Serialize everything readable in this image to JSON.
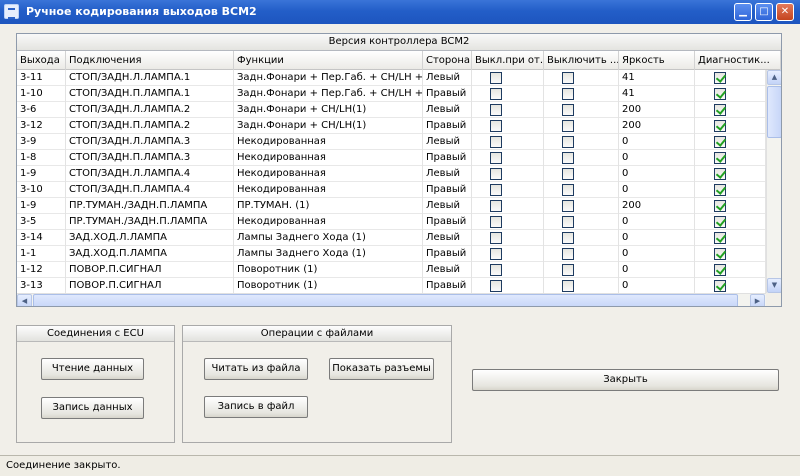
{
  "window": {
    "title": "Ручное кодирования выходов BCM2",
    "icon": "app-icon"
  },
  "grid": {
    "caption": "Версия контроллера BCM2",
    "columns": [
      "Выхода",
      "Подключения",
      "Функции",
      "Сторона",
      "Выкл.при от...",
      "Выключить ...",
      "Яркость",
      "Диагностик..."
    ],
    "rows": [
      {
        "out": "3-11",
        "conn": "СТОП/ЗАДН.Л.ЛАМПА.1",
        "func": "Задн.Фонари + Пер.Габ. + CH/LH +...",
        "side": "Левый",
        "off_when": false,
        "turn_off": false,
        "brightness": "41",
        "diag": true
      },
      {
        "out": "1-10",
        "conn": "СТОП/ЗАДН.П.ЛАМПА.1",
        "func": "Задн.Фонари + Пер.Габ. + CH/LH +...",
        "side": "Правый",
        "off_when": false,
        "turn_off": false,
        "brightness": "41",
        "diag": true
      },
      {
        "out": "3-6",
        "conn": "СТОП/ЗАДН.Л.ЛАМПА.2",
        "func": "Задн.Фонари + CH/LH(1)",
        "side": "Левый",
        "off_when": false,
        "turn_off": false,
        "brightness": "200",
        "diag": true
      },
      {
        "out": "3-12",
        "conn": "СТОП/ЗАДН.П.ЛАМПА.2",
        "func": "Задн.Фонари + CH/LH(1)",
        "side": "Правый",
        "off_when": false,
        "turn_off": false,
        "brightness": "200",
        "diag": true
      },
      {
        "out": "3-9",
        "conn": "СТОП/ЗАДН.Л.ЛАМПА.3",
        "func": "Некодированная",
        "side": "Левый",
        "off_when": false,
        "turn_off": false,
        "brightness": "0",
        "diag": true
      },
      {
        "out": "1-8",
        "conn": "СТОП/ЗАДН.П.ЛАМПА.3",
        "func": "Некодированная",
        "side": "Правый",
        "off_when": false,
        "turn_off": false,
        "brightness": "0",
        "diag": true
      },
      {
        "out": "1-9",
        "conn": "СТОП/ЗАДН.Л.ЛАМПА.4",
        "func": "Некодированная",
        "side": "Левый",
        "off_when": false,
        "turn_off": false,
        "brightness": "0",
        "diag": true
      },
      {
        "out": "3-10",
        "conn": "СТОП/ЗАДН.П.ЛАМПА.4",
        "func": "Некодированная",
        "side": "Правый",
        "off_when": false,
        "turn_off": false,
        "brightness": "0",
        "diag": true
      },
      {
        "out": "1-9",
        "conn": "ПР.ТУМАН./ЗАДН.П.ЛАМПА",
        "func": "ПР.ТУМАН. (1)",
        "side": "Левый",
        "off_when": false,
        "turn_off": false,
        "brightness": "200",
        "diag": true
      },
      {
        "out": "3-5",
        "conn": "ПР.ТУМАН./ЗАДН.П.ЛАМПА",
        "func": "Некодированная",
        "side": "Правый",
        "off_when": false,
        "turn_off": false,
        "brightness": "0",
        "diag": true
      },
      {
        "out": "3-14",
        "conn": "ЗАД.ХОД.Л.ЛАМПА",
        "func": "Лампы Заднего Хода (1)",
        "side": "Левый",
        "off_when": false,
        "turn_off": false,
        "brightness": "0",
        "diag": true
      },
      {
        "out": "1-1",
        "conn": "ЗАД.ХОД.П.ЛАМПА",
        "func": "Лампы Заднего Хода (1)",
        "side": "Правый",
        "off_when": false,
        "turn_off": false,
        "brightness": "0",
        "diag": true
      },
      {
        "out": "1-12",
        "conn": "ПОВОР.П.СИГНАЛ",
        "func": "Поворотник (1)",
        "side": "Левый",
        "off_when": false,
        "turn_off": false,
        "brightness": "0",
        "diag": true
      },
      {
        "out": "3-13",
        "conn": "ПОВОР.П.СИГНАЛ",
        "func": "Поворотник (1)",
        "side": "Правый",
        "off_when": false,
        "turn_off": false,
        "brightness": "0",
        "diag": true
      }
    ]
  },
  "ecu_group": {
    "title": "Соединения с ECU",
    "read_label": "Чтение данных",
    "write_label": "Запись данных"
  },
  "file_group": {
    "title": "Операции с файлами",
    "read_file_label": "Читать из файла",
    "show_connectors_label": "Показать разъемы",
    "write_file_label": "Запись в файл"
  },
  "close_label": "Закрыть",
  "status_text": "Соединение закрыто."
}
